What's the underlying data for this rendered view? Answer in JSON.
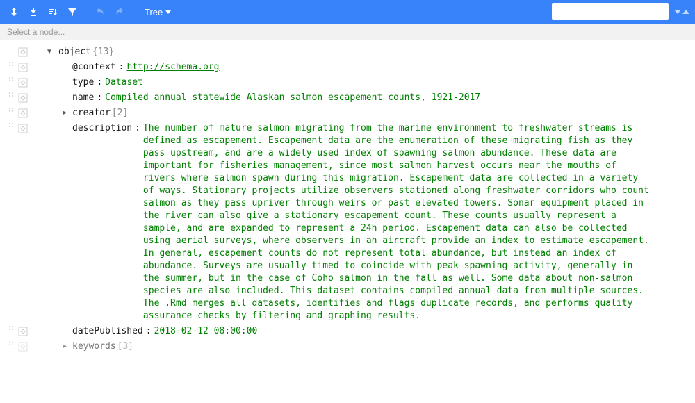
{
  "toolbar": {
    "mode_label": "Tree"
  },
  "breadcrumb": {
    "placeholder": "Select a node..."
  },
  "tree": {
    "root_label": "object",
    "root_count": "{13}",
    "nodes": {
      "context": {
        "key": "@context",
        "value": "http://schema.org"
      },
      "type": {
        "key": "type",
        "value": "Dataset"
      },
      "name": {
        "key": "name",
        "value": "Compiled annual statewide Alaskan salmon escapement counts, 1921-2017"
      },
      "creator": {
        "key": "creator",
        "count": "[2]"
      },
      "description": {
        "key": "description",
        "value": "The number of mature salmon migrating from the marine environment to freshwater streams is defined as escapement. Escapement data are the enumeration of these migrating fish as they pass upstream, and are a widely used index of spawning salmon abundance. These data are important for fisheries management, since most salmon harvest occurs near the mouths of rivers where salmon spawn during this migration. Escapement data are collected in a variety of ways. Stationary projects utilize observers stationed along freshwater corridors who count salmon as they pass upriver through weirs or past elevated towers. Sonar equipment placed in the river can also give a stationary escapement count. These counts usually represent a sample, and are expanded to represent a 24h period. Escapement data can also be collected using aerial surveys, where observers in an aircraft provide an index to estimate escapement. In general, escapement counts do not represent total abundance, but instead an index of abundance. Surveys are usually timed to coincide with peak spawning activity, generally in the summer, but in the case of Coho salmon in the fall as well. Some data about non-salmon species are also included. This dataset contains compiled annual data from multiple sources. The .Rmd merges all datasets, identifies and flags duplicate records, and performs quality assurance checks by filtering and graphing results."
      },
      "datePublished": {
        "key": "datePublished",
        "value": "2018-02-12 08:00:00"
      },
      "keywords": {
        "key": "keywords",
        "count": "[3]"
      }
    }
  }
}
